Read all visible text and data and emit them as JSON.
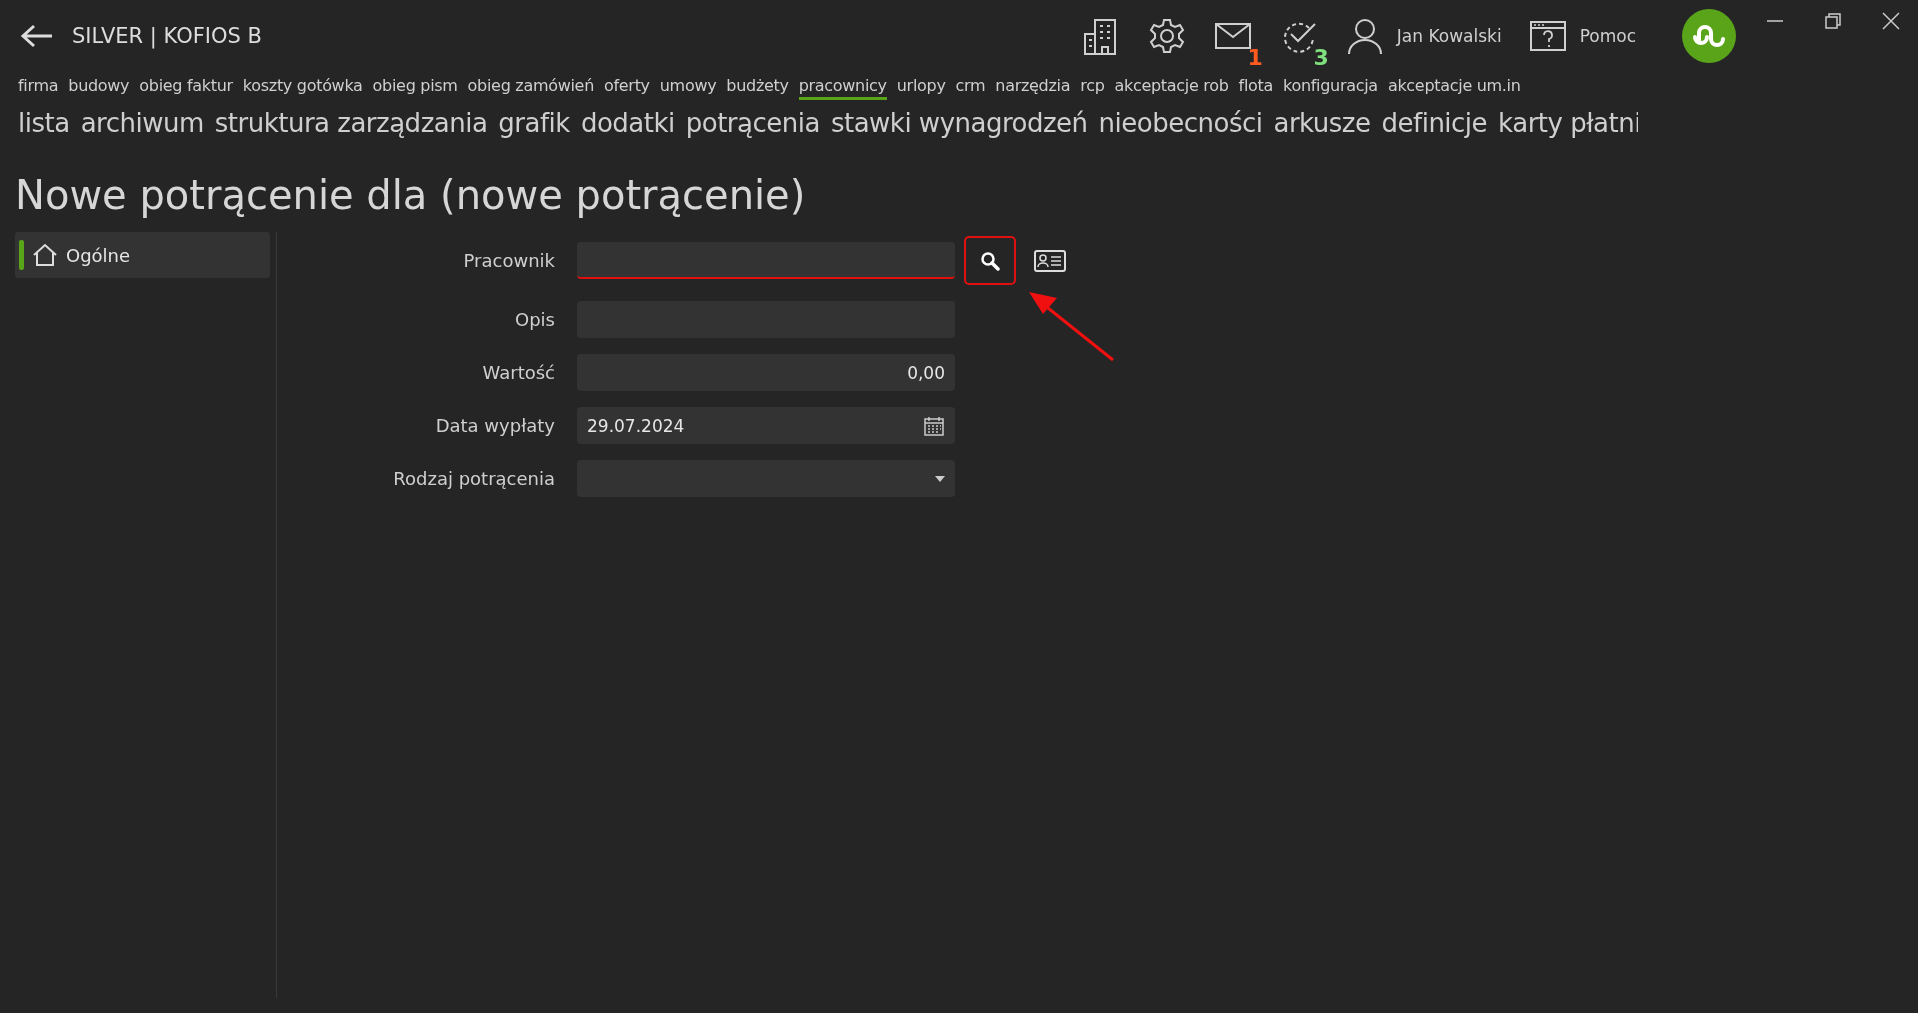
{
  "window": {
    "title": "SILVER | KOFIOS B"
  },
  "toolbar": {
    "badges": [
      {
        "kind": "mail",
        "count": "1",
        "color": "#ff5a1f"
      },
      {
        "kind": "tasks",
        "count": "3",
        "color": "#7ee07e"
      }
    ],
    "user": "Jan Kowalski",
    "help": "Pomoc"
  },
  "nav": [
    {
      "label": "firma",
      "selected": false
    },
    {
      "label": "budowy",
      "selected": false
    },
    {
      "label": "obieg faktur",
      "selected": false
    },
    {
      "label": "koszty gotówka",
      "selected": false
    },
    {
      "label": "obieg pism",
      "selected": false
    },
    {
      "label": "obieg zamówień",
      "selected": false
    },
    {
      "label": "oferty",
      "selected": false
    },
    {
      "label": "umowy",
      "selected": false
    },
    {
      "label": "budżety",
      "selected": false
    },
    {
      "label": "pracownicy",
      "selected": true
    },
    {
      "label": "urlopy",
      "selected": false
    },
    {
      "label": "crm",
      "selected": false
    },
    {
      "label": "narzędzia",
      "selected": false
    },
    {
      "label": "rcp",
      "selected": false
    },
    {
      "label": "akceptacje rob",
      "selected": false
    },
    {
      "label": "flota",
      "selected": false
    },
    {
      "label": "konfiguracja",
      "selected": false
    },
    {
      "label": "akceptacje um.in",
      "selected": false
    }
  ],
  "subnav": [
    "lista",
    "archiwum",
    "struktura zarządzania",
    "grafik",
    "dodatki",
    "potrącenia",
    "stawki wynagrodzeń",
    "nieobecności",
    "arkusze",
    "definicje",
    "karty płatni"
  ],
  "page_title": "Nowe potrącenie dla (nowe potrącenie)",
  "sidebar": {
    "items": [
      {
        "label": "Ogólne",
        "selected": true
      }
    ]
  },
  "form": {
    "fields": [
      {
        "label": "Pracownik",
        "kind": "lookup",
        "invalid": true
      },
      {
        "label": "Opis",
        "kind": "text",
        "invalid": false
      },
      {
        "label": "Wartość",
        "kind": "number",
        "value": "0,00",
        "invalid": false
      },
      {
        "label": "Data wypłaty",
        "kind": "date",
        "value": "29.07.2024",
        "invalid": false
      },
      {
        "label": "Rodzaj potrącenia",
        "kind": "select",
        "invalid": false
      }
    ]
  }
}
